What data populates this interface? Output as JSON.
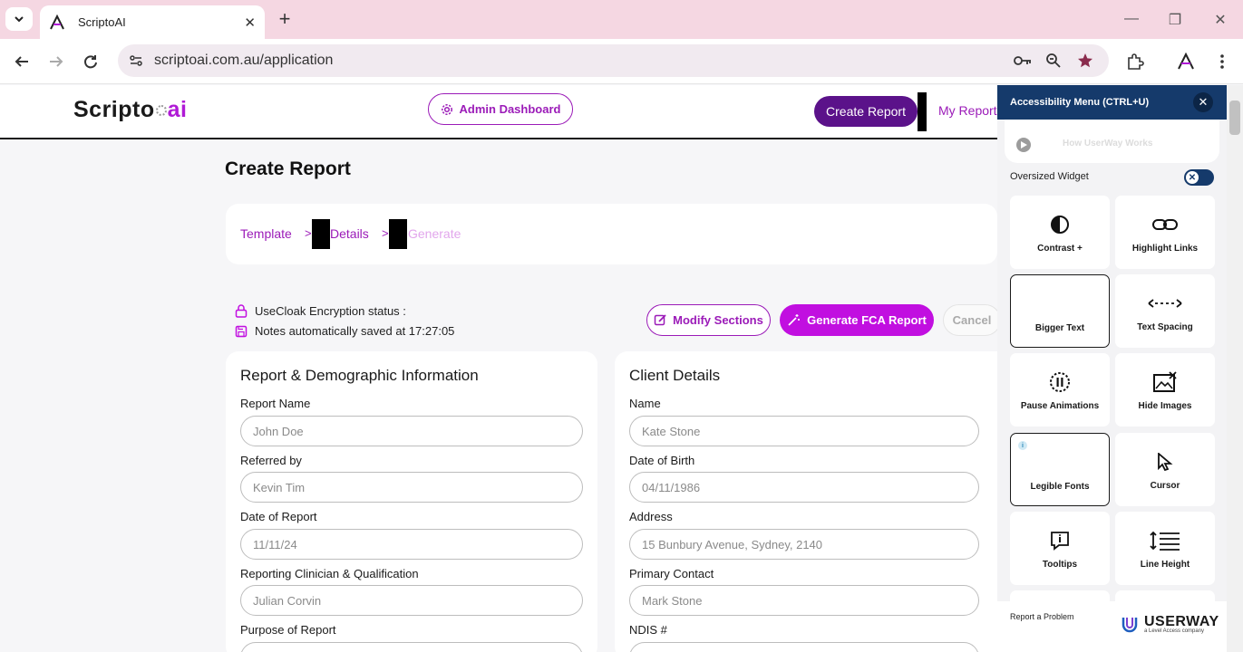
{
  "browser": {
    "tab_title": "ScriptoAI",
    "url": "scriptoai.com.au/application"
  },
  "header": {
    "logo_main": "Scripto",
    "logo_accent": "ai",
    "admin_label": "Admin Dashboard",
    "create_label": "Create Report",
    "my_report_label": "My Report"
  },
  "page": {
    "title": "Create Report"
  },
  "stepper": {
    "step1": "Template",
    "step2": "Details",
    "step3": "Generate",
    "separator": ">"
  },
  "status": {
    "encryption": "UseCloak Encryption status :",
    "saved": "Notes automatically saved at 17:27:05"
  },
  "actions": {
    "modify": "Modify Sections",
    "generate": "Generate FCA Report",
    "cancel": "Cancel"
  },
  "report_card": {
    "title": "Report & Demographic Information",
    "fields": [
      {
        "label": "Report Name",
        "value": "John Doe"
      },
      {
        "label": "Referred by",
        "value": "Kevin Tim"
      },
      {
        "label": "Date of Report",
        "value": "11/11/24"
      },
      {
        "label": "Reporting Clinician & Qualification",
        "value": "Julian Corvin"
      },
      {
        "label": "Purpose of Report",
        "value": ""
      }
    ]
  },
  "client_card": {
    "title": "Client Details",
    "fields": [
      {
        "label": "Name",
        "value": "Kate Stone"
      },
      {
        "label": "Date of Birth",
        "value": "04/11/1986"
      },
      {
        "label": "Address",
        "value": "15 Bunbury Avenue, Sydney, 2140"
      },
      {
        "label": "Primary Contact",
        "value": "Mark Stone"
      },
      {
        "label": "NDIS #",
        "value": ""
      }
    ]
  },
  "accessibility": {
    "title": "Accessibility Menu (CTRL+U)",
    "how_it_works": "How UserWay Works",
    "oversized": "Oversized Widget",
    "tiles": [
      {
        "label": "Contrast +",
        "icon": "contrast-icon"
      },
      {
        "label": "Highlight Links",
        "icon": "link-icon"
      },
      {
        "label": "Bigger Text",
        "icon": "text-size-icon"
      },
      {
        "label": "Text Spacing",
        "icon": "text-spacing-icon"
      },
      {
        "label": "Pause Animations",
        "icon": "pause-icon"
      },
      {
        "label": "Hide Images",
        "icon": "hide-image-icon"
      },
      {
        "label": "Legible Fonts",
        "icon": "font-icon"
      },
      {
        "label": "Cursor",
        "icon": "cursor-icon"
      },
      {
        "label": "Tooltips",
        "icon": "tooltip-icon"
      },
      {
        "label": "Line Height",
        "icon": "line-height-icon"
      }
    ],
    "report_problem": "Report a Problem",
    "brand": "USERWAY",
    "brand_sub": "a Level Access company"
  },
  "colors": {
    "brand_purple": "#9b1bb8",
    "create_purple": "#5b128a",
    "generate_magenta": "#c10fe0",
    "acc_navy": "#153a6b"
  }
}
